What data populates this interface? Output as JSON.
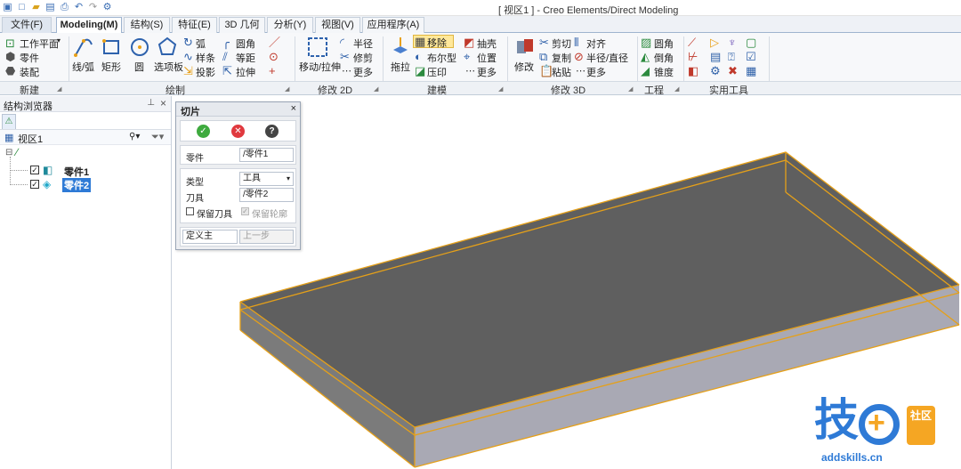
{
  "window": {
    "title": "[ 视区1 ] - Creo Elements/Direct Modeling"
  },
  "quick_access": [
    "view-icon",
    "new-icon",
    "open-icon",
    "save-icon",
    "print-icon",
    "undo-icon",
    "redo-icon",
    "customize-icon"
  ],
  "tabs": [
    {
      "label": "文件(F)",
      "active": false
    },
    {
      "label": "Modeling(M)",
      "active": true
    },
    {
      "label": "结构(S)",
      "active": false
    },
    {
      "label": "特征(E)",
      "active": false
    },
    {
      "label": "3D 几何",
      "active": false
    },
    {
      "label": "分析(Y)",
      "active": false
    },
    {
      "label": "视图(V)",
      "active": false
    },
    {
      "label": "应用程序(A)",
      "active": false
    }
  ],
  "ribbon": {
    "new": {
      "workplane": "工作平面",
      "part": "零件",
      "assembly": "装配"
    },
    "draw": {
      "line_arc": "线/弧",
      "rect": "矩形",
      "circle": "圆",
      "options": "选项板",
      "arc": "弧",
      "spline": "样条",
      "project": "投影",
      "fillet": "圆角",
      "offset": "等距",
      "stretch": "拉伸"
    },
    "modify2d": {
      "move_stretch": "移动/拉伸",
      "radius": "半径",
      "trim": "修剪",
      "more": "更多"
    },
    "model": {
      "pull": "拖拉",
      "move": "移除",
      "boolean": "布尔型",
      "imprint": "压印",
      "shell": "抽壳",
      "position": "位置",
      "more": "更多"
    },
    "modify3d": {
      "modify": "修改",
      "cut": "剪切",
      "copy": "复制",
      "paste": "粘贴",
      "align": "对齐",
      "radius_dia": "半径/直径",
      "more": "更多"
    },
    "eng": {
      "fillet": "圆角",
      "chamfer": "倒角",
      "taper": "锥度"
    },
    "groups": [
      "新建",
      "绘制",
      "修改 2D",
      "建模",
      "修改 3D",
      "工程",
      "实用工具"
    ]
  },
  "browser": {
    "title": "结构浏览器",
    "view": "视区1",
    "items": [
      {
        "label": "零件1",
        "checked": true,
        "selected": false
      },
      {
        "label": "零件2",
        "checked": true,
        "selected": true
      }
    ]
  },
  "dialog": {
    "title": "切片",
    "part_label": "零件",
    "part_value": "/零件1",
    "type_label": "类型",
    "type_value": "工具",
    "tool_label": "刀具",
    "tool_value": "/零件2",
    "keep_tool": "保留刀具",
    "keep_profile": "保留轮廓",
    "define": "定义主",
    "prev": "上一步"
  },
  "watermark": {
    "text": "技",
    "badge": "社区",
    "url": "addskills.cn"
  },
  "colors": {
    "accent": "#2e62ad",
    "highlight": "#f5a623",
    "body_top": "#5f5f5f",
    "body_side": "#a9a9b4",
    "edge": "#e5a019"
  }
}
